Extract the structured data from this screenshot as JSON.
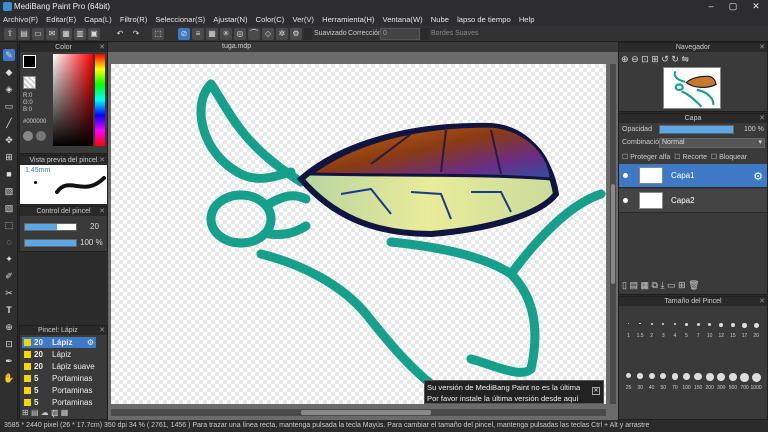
{
  "window": {
    "title": "MediBang Paint Pro (64bit)"
  },
  "menu": [
    "Archivo(F)",
    "Editar(E)",
    "Capa(L)",
    "Filtro(R)",
    "Seleccionar(S)",
    "Ajustar(N)",
    "Color(C)",
    "Ver(V)",
    "Herramienta(H)",
    "Ventana(W)",
    "Nube",
    "lapso de tiempo",
    "Help"
  ],
  "toolbar": {
    "smooth_label": "Suavizado",
    "correction_label": "Corrección",
    "correction_value": "0",
    "soft_edges_label": "Bordes Suaves"
  },
  "document": {
    "tab": "tuga.mdp"
  },
  "color_panel": {
    "title": "Color",
    "r": "R:0",
    "g": "G:0",
    "b": "B:0",
    "hex": "#000000"
  },
  "brush_preview": {
    "title": "Vista previa del pincel",
    "size": "1.45mm"
  },
  "brush_control": {
    "title": "Control del pincel",
    "size_value": "20",
    "opacity_value": "100",
    "opacity_unit": "%",
    "size_fill": 0.62,
    "opacity_fill": 1.0
  },
  "brush_list": {
    "title": "Pincel: Lápiz",
    "items": [
      {
        "size": "20",
        "name": "Lápiz"
      },
      {
        "size": "20",
        "name": "Lápiz (ásperc"
      },
      {
        "size": "20",
        "name": "Lápiz suave ("
      },
      {
        "size": "5",
        "name": "Portaminas ("
      },
      {
        "size": "5",
        "name": "Portaminas ("
      },
      {
        "size": "5",
        "name": "Portaminas ("
      }
    ]
  },
  "navigator": {
    "title": "Navegador"
  },
  "layer_panel": {
    "title": "Capa",
    "opacity_label": "Opacidad",
    "opacity_value": "100 %",
    "opacity_fill": 1.0,
    "blend_label": "Combinación",
    "blend_value": "Normal",
    "protect_alpha": "Proteger alfa",
    "clip": "Recorte",
    "lock": "Bloquear",
    "layers": [
      {
        "name": "Capa1"
      },
      {
        "name": "Capa2"
      }
    ]
  },
  "brush_size_panel": {
    "title": "Tamaño del Pincel",
    "row1": [
      "1",
      "1.5",
      "2",
      "3",
      "4",
      "5",
      "7",
      "10",
      "12",
      "15",
      "17",
      "20"
    ],
    "row2": [
      "25",
      "30",
      "40",
      "50",
      "70",
      "100",
      "150",
      "200",
      "300",
      "500",
      "700",
      "1000"
    ]
  },
  "notice": {
    "line1": "Su versión de MediBang Paint no es la última",
    "line2": "Por favor instale la última versión desde aquí"
  },
  "status": {
    "text": "3585 * 2440 pixel   (26 * 17.7cm)   350 dpi   34 %   ( 2761, 1456 )   Para trazar una línea recta, mantenga pulsada la tecla Mayús. Para cambiar el tamaño del pincel, mantenga pulsadas las teclas Ctrl + Alt y arrastre"
  },
  "colors": {
    "accent": "#3d79c4",
    "turtle_outline": "#14a08a",
    "brush_swatch": "#f5d800"
  }
}
